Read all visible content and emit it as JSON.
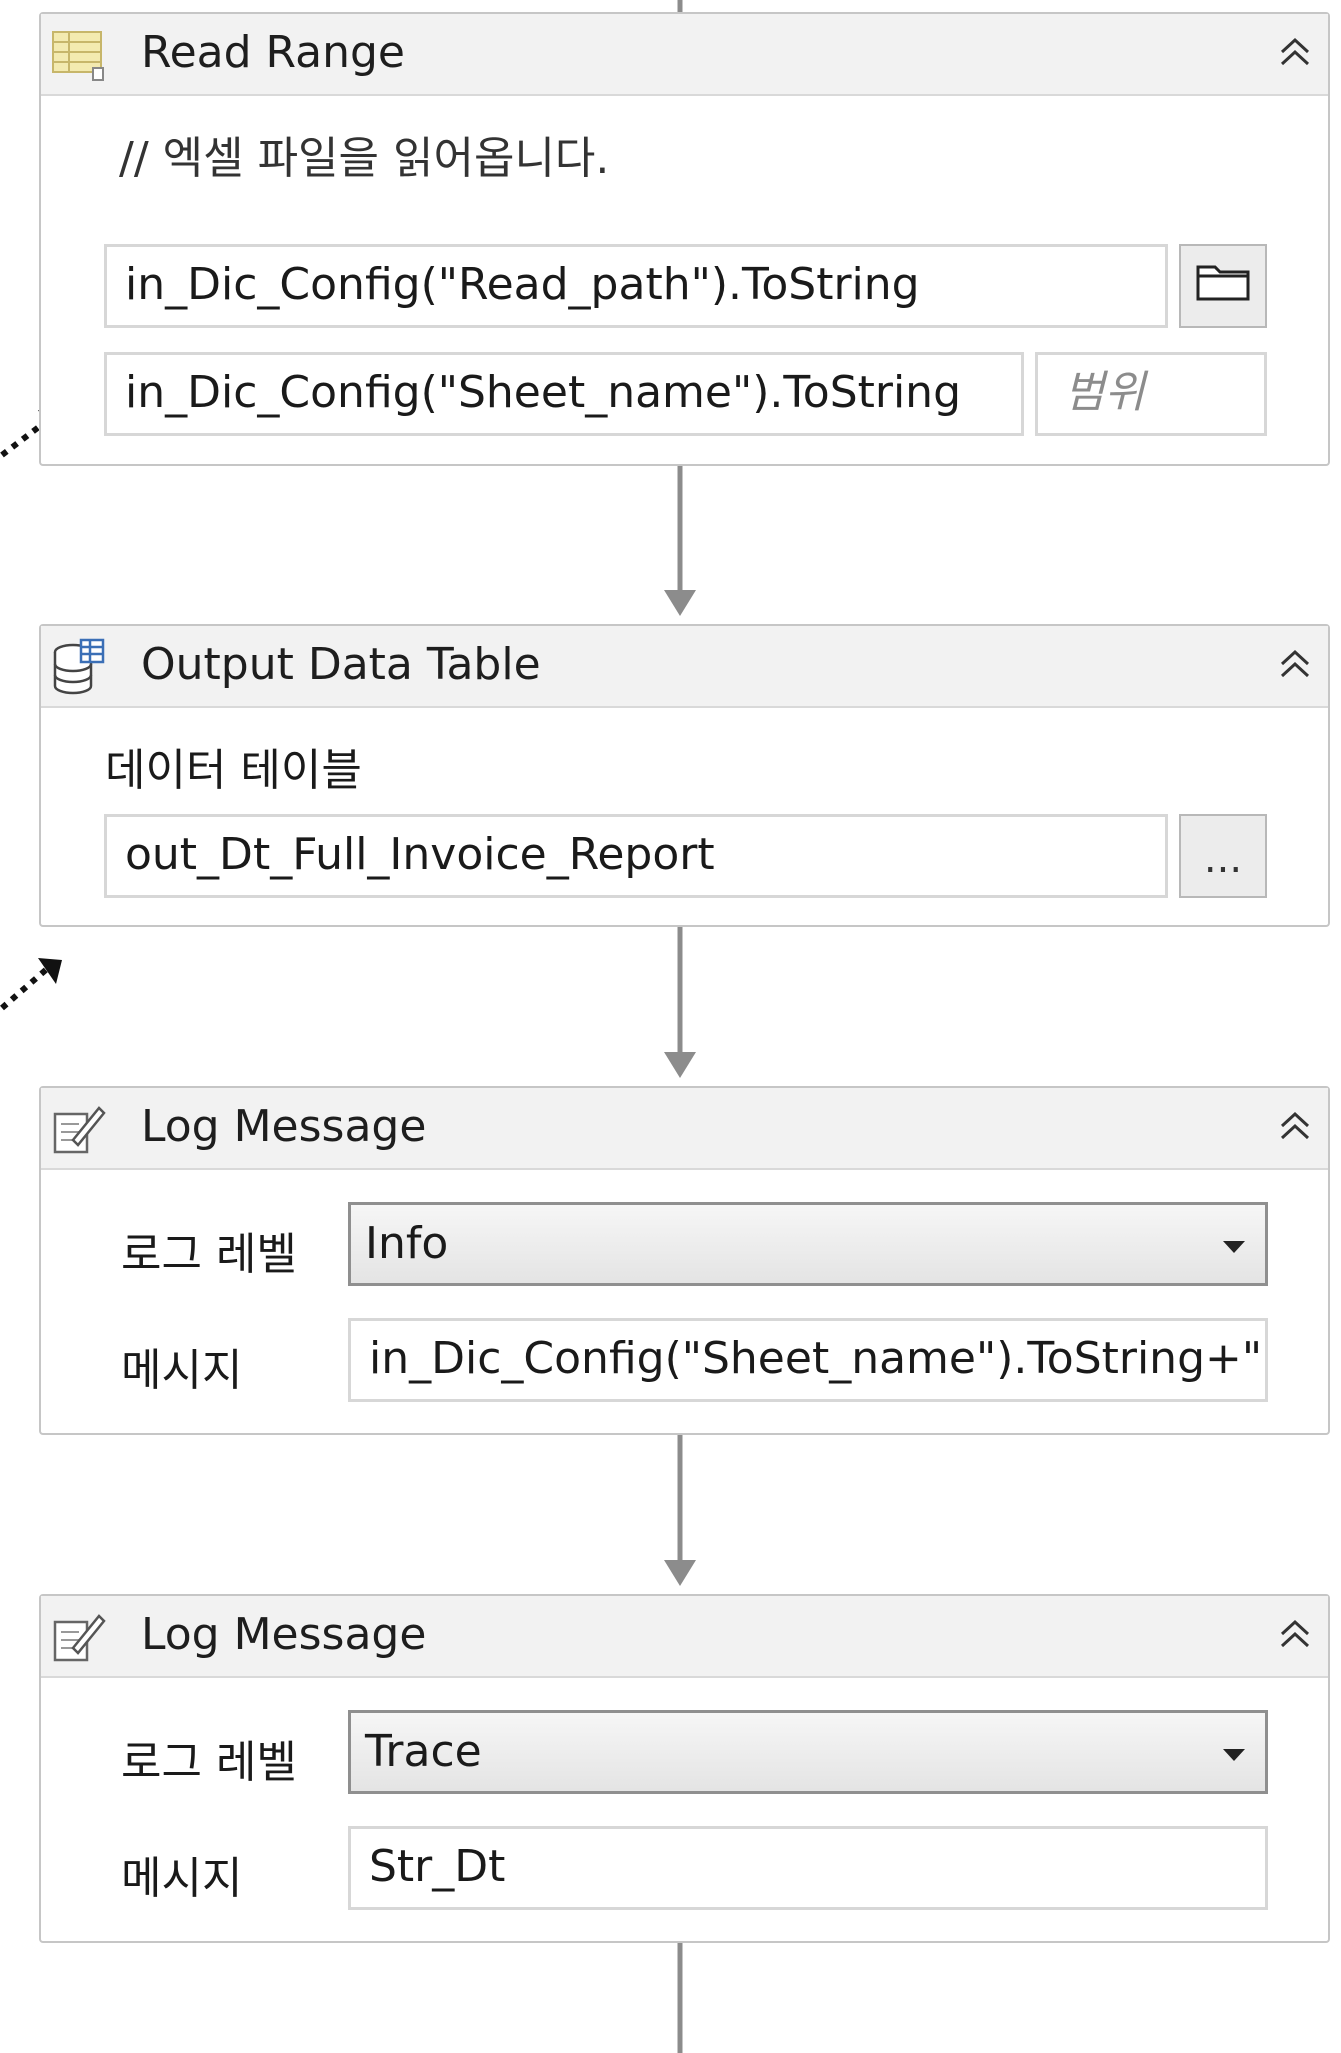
{
  "read_range": {
    "title": "Read Range",
    "comment": "// 엑셀 파일을 읽어옵니다.",
    "workbook_path": "in_Dic_Config(\"Read_path\").ToString",
    "sheet_name": "in_Dic_Config(\"Sheet_name\").ToString",
    "range_placeholder": "범위",
    "icon": "spreadsheet-icon"
  },
  "output_data_table": {
    "title": "Output Data Table",
    "field_label": "데이터 테이블",
    "value": "out_Dt_Full_Invoice_Report",
    "button_label": "...",
    "icon": "database-icon"
  },
  "log_message_1": {
    "title": "Log Message",
    "level_label": "로그 레벨",
    "level_value": "Info",
    "message_label": "메시지",
    "message_value": "in_Dic_Config(\"Sheet_name\").ToString+\" :",
    "icon": "log-note-icon"
  },
  "log_message_2": {
    "title": "Log Message",
    "level_label": "로그 레벨",
    "level_value": "Trace",
    "message_label": "메시지",
    "message_value": "Str_Dt",
    "icon": "log-note-icon"
  },
  "colors": {
    "header_bg": "#f2f2f2",
    "border": "#c6c6c6",
    "connector": "#8a8a8a"
  }
}
